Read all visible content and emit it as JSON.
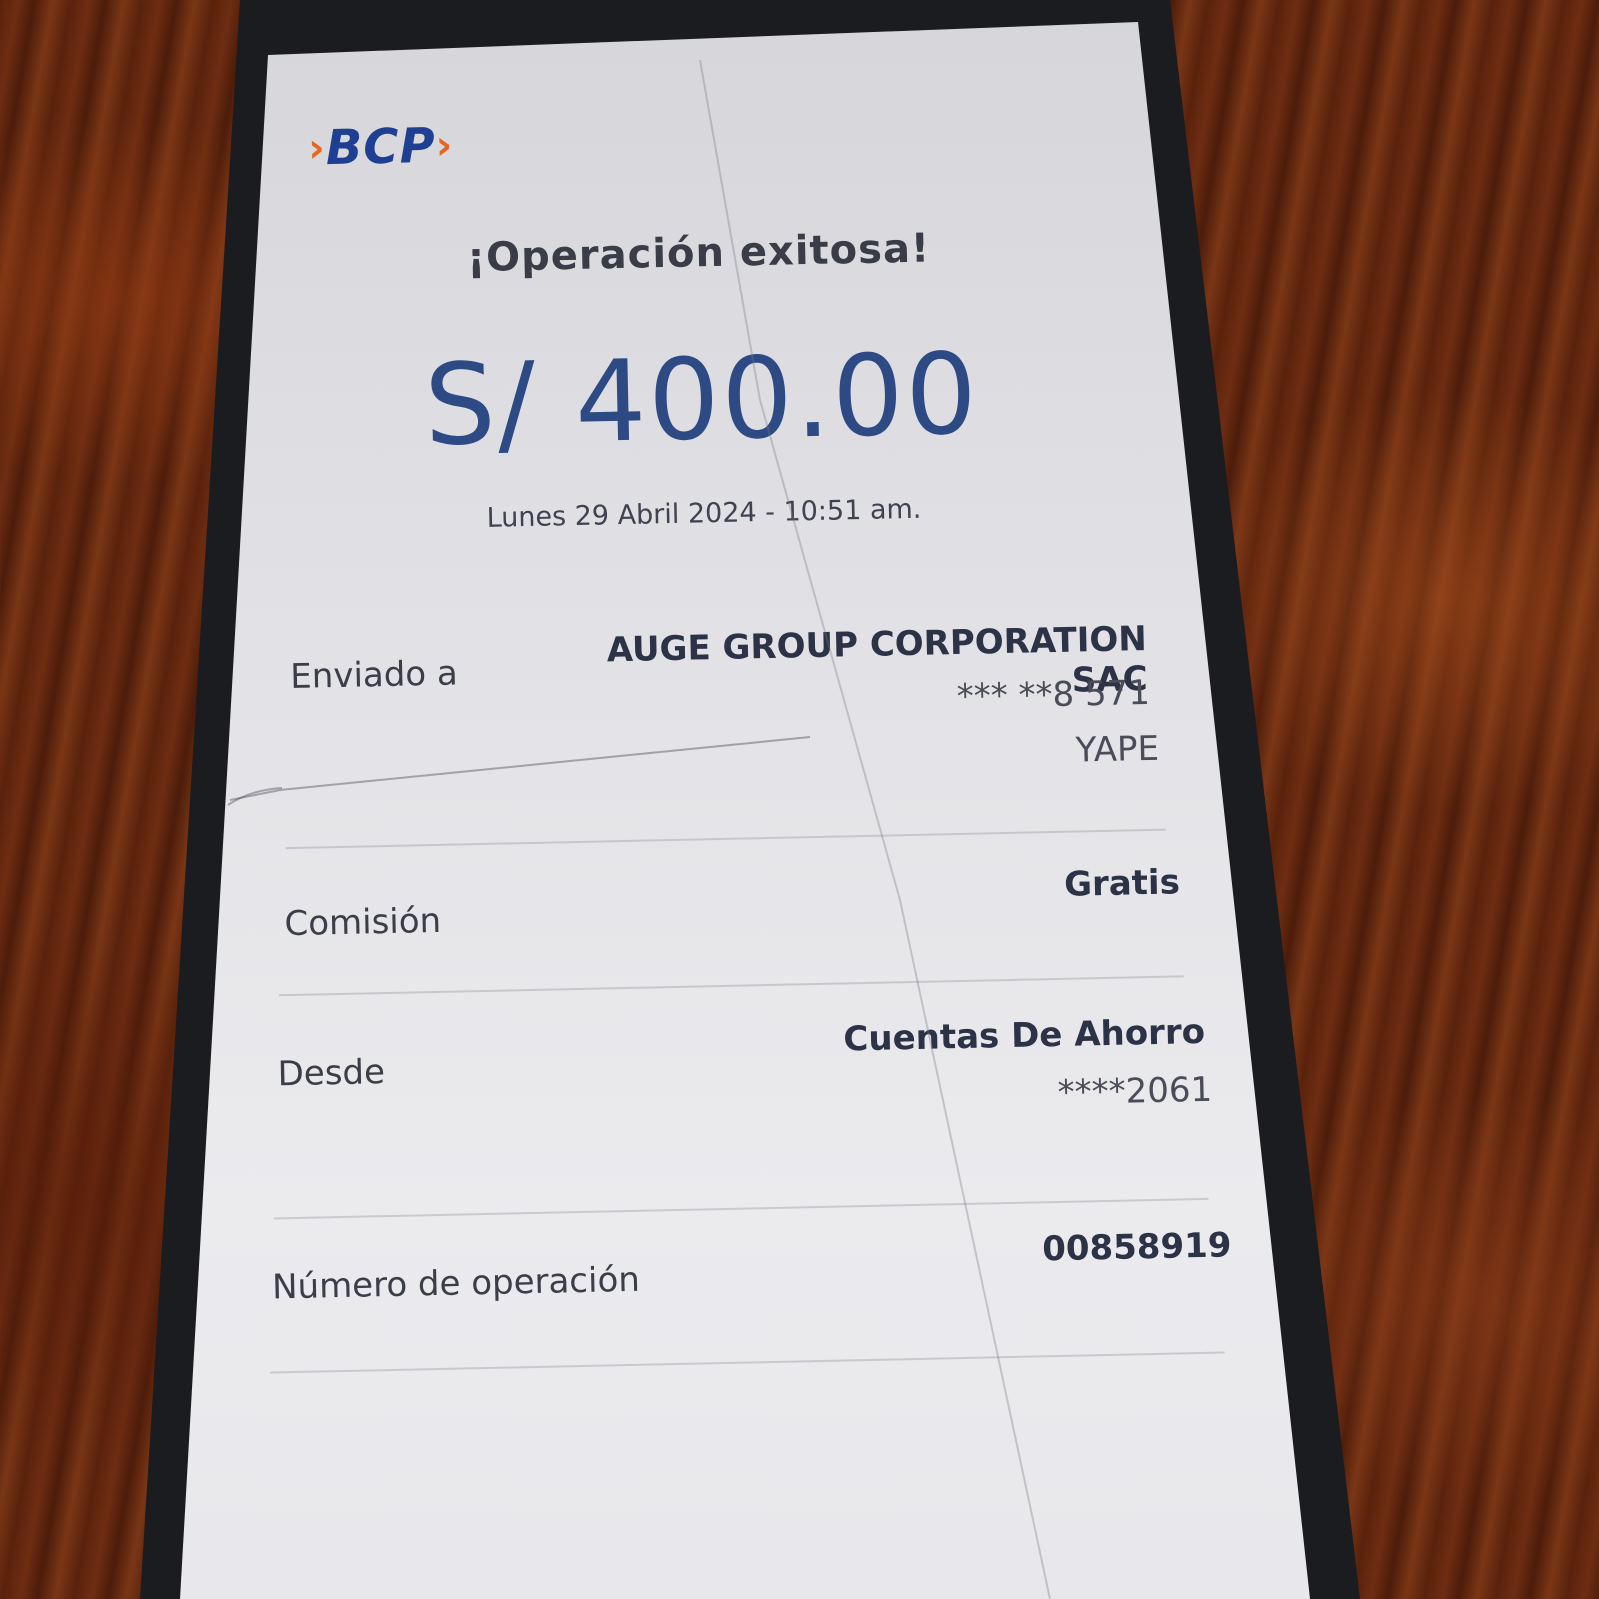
{
  "header": {
    "logo_text": "BCP",
    "logo_left_chevron": "›",
    "logo_right_chevron": "›"
  },
  "receipt": {
    "title": "¡Operación exitosa!",
    "amount": "S/ 400.00",
    "datetime": "Lunes 29 Abril 2024 - 10:51 am."
  },
  "rows": {
    "sent_to": {
      "label": "Enviado a",
      "name": "AUGE GROUP CORPORATION SAC",
      "phone": "*** **8 571",
      "channel": "YAPE"
    },
    "commission": {
      "label": "Comisión",
      "value": "Gratis"
    },
    "from": {
      "label": "Desde",
      "account_type": "Cuentas De Ahorro",
      "account_number": "****2061"
    },
    "operation_number": {
      "label": "Número de operación",
      "value": "00858919"
    }
  },
  "colors": {
    "brand_blue": "#1f3f92",
    "brand_orange": "#e8661f",
    "amount_blue": "#2e4a85"
  }
}
